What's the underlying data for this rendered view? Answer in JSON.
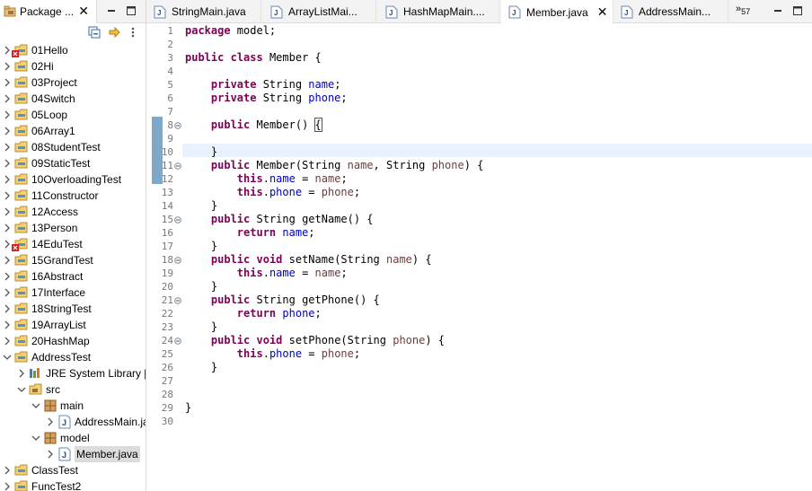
{
  "package_explorer": {
    "tab_label": "Package ...",
    "tree": [
      {
        "label": "01Hello",
        "level": 0,
        "type": "project",
        "state": "collapsed",
        "error": true
      },
      {
        "label": "02Hi",
        "level": 0,
        "type": "project",
        "state": "collapsed",
        "error": false
      },
      {
        "label": "03Project",
        "level": 0,
        "type": "project",
        "state": "collapsed",
        "error": false
      },
      {
        "label": "04Switch",
        "level": 0,
        "type": "project",
        "state": "collapsed",
        "error": false
      },
      {
        "label": "05Loop",
        "level": 0,
        "type": "project",
        "state": "collapsed",
        "error": false
      },
      {
        "label": "06Array1",
        "level": 0,
        "type": "project",
        "state": "collapsed",
        "error": false
      },
      {
        "label": "08StudentTest",
        "level": 0,
        "type": "project",
        "state": "collapsed",
        "error": false
      },
      {
        "label": "09StaticTest",
        "level": 0,
        "type": "project",
        "state": "collapsed",
        "error": false
      },
      {
        "label": "10OverloadingTest",
        "level": 0,
        "type": "project",
        "state": "collapsed",
        "error": false
      },
      {
        "label": "11Constructor",
        "level": 0,
        "type": "project",
        "state": "collapsed",
        "error": false
      },
      {
        "label": "12Access",
        "level": 0,
        "type": "project",
        "state": "collapsed",
        "error": false
      },
      {
        "label": "13Person",
        "level": 0,
        "type": "project",
        "state": "collapsed",
        "error": false
      },
      {
        "label": "14EduTest",
        "level": 0,
        "type": "project",
        "state": "collapsed",
        "error": true
      },
      {
        "label": "15GrandTest",
        "level": 0,
        "type": "project",
        "state": "collapsed",
        "error": false
      },
      {
        "label": "16Abstract",
        "level": 0,
        "type": "project",
        "state": "collapsed",
        "error": false
      },
      {
        "label": "17Interface",
        "level": 0,
        "type": "project",
        "state": "collapsed",
        "error": false
      },
      {
        "label": "18StringTest",
        "level": 0,
        "type": "project",
        "state": "collapsed",
        "error": false
      },
      {
        "label": "19ArrayList",
        "level": 0,
        "type": "project",
        "state": "collapsed",
        "error": false
      },
      {
        "label": "20HashMap",
        "level": 0,
        "type": "project",
        "state": "collapsed",
        "error": false
      },
      {
        "label": "AddressTest",
        "level": 0,
        "type": "project",
        "state": "expanded",
        "error": false
      },
      {
        "label": "JRE System Library [J",
        "level": 1,
        "type": "library",
        "state": "collapsed",
        "error": false
      },
      {
        "label": "src",
        "level": 1,
        "type": "srcfolder",
        "state": "expanded",
        "error": false
      },
      {
        "label": "main",
        "level": 2,
        "type": "package",
        "state": "expanded",
        "error": false
      },
      {
        "label": "AddressMain.ja",
        "level": 3,
        "type": "javafile",
        "state": "collapsed",
        "error": false
      },
      {
        "label": "model",
        "level": 2,
        "type": "package",
        "state": "expanded",
        "error": false
      },
      {
        "label": "Member.java",
        "level": 3,
        "type": "javafile",
        "state": "collapsed",
        "error": false,
        "selected": true
      },
      {
        "label": "ClassTest",
        "level": 0,
        "type": "project",
        "state": "collapsed",
        "error": false
      },
      {
        "label": "FuncTest2",
        "level": 0,
        "type": "project",
        "state": "collapsed",
        "error": false
      }
    ]
  },
  "editor": {
    "tabs": [
      {
        "label": "StringMain.java",
        "active": false
      },
      {
        "label": "ArrayListMai...",
        "active": false
      },
      {
        "label": "HashMapMain....",
        "active": false
      },
      {
        "label": "Member.java",
        "active": true
      },
      {
        "label": "AddressMain...",
        "active": false
      }
    ],
    "overflow_label": "»",
    "overflow_count": "57",
    "lines": [
      {
        "n": "1",
        "fold": false,
        "tokens": [
          [
            "kw",
            "package"
          ],
          [
            "t",
            " model;"
          ]
        ]
      },
      {
        "n": "2",
        "fold": false,
        "tokens": []
      },
      {
        "n": "3",
        "fold": false,
        "tokens": [
          [
            "kw",
            "public"
          ],
          [
            "t",
            " "
          ],
          [
            "kw",
            "class"
          ],
          [
            "t",
            " Member {"
          ]
        ]
      },
      {
        "n": "4",
        "fold": false,
        "tokens": []
      },
      {
        "n": "5",
        "fold": false,
        "tokens": [
          [
            "t",
            "    "
          ],
          [
            "kw",
            "private"
          ],
          [
            "t",
            " String "
          ],
          [
            "fld",
            "name"
          ],
          [
            "t",
            ";"
          ]
        ]
      },
      {
        "n": "6",
        "fold": false,
        "tokens": [
          [
            "t",
            "    "
          ],
          [
            "kw",
            "private"
          ],
          [
            "t",
            " String "
          ],
          [
            "fld",
            "phone"
          ],
          [
            "t",
            ";"
          ]
        ]
      },
      {
        "n": "7",
        "fold": false,
        "tokens": []
      },
      {
        "n": "8",
        "fold": true,
        "tokens": [
          [
            "t",
            "    "
          ],
          [
            "kw",
            "public"
          ],
          [
            "t",
            " Member() "
          ],
          [
            "box",
            "{"
          ]
        ]
      },
      {
        "n": "9",
        "fold": false,
        "tokens": []
      },
      {
        "n": "10",
        "fold": false,
        "tokens": [
          [
            "t",
            "    }"
          ]
        ]
      },
      {
        "n": "11",
        "fold": true,
        "tokens": [
          [
            "t",
            "    "
          ],
          [
            "kw",
            "public"
          ],
          [
            "t",
            " Member(String "
          ],
          [
            "prm",
            "name"
          ],
          [
            "t",
            ", String "
          ],
          [
            "prm",
            "phone"
          ],
          [
            "t",
            ") {"
          ]
        ]
      },
      {
        "n": "12",
        "fold": false,
        "tokens": [
          [
            "t",
            "        "
          ],
          [
            "kw",
            "this"
          ],
          [
            "t",
            "."
          ],
          [
            "fld",
            "name"
          ],
          [
            "t",
            " = "
          ],
          [
            "prm",
            "name"
          ],
          [
            "t",
            ";"
          ]
        ]
      },
      {
        "n": "13",
        "fold": false,
        "tokens": [
          [
            "t",
            "        "
          ],
          [
            "kw",
            "this"
          ],
          [
            "t",
            "."
          ],
          [
            "fld",
            "phone"
          ],
          [
            "t",
            " = "
          ],
          [
            "prm",
            "phone"
          ],
          [
            "t",
            ";"
          ]
        ]
      },
      {
        "n": "14",
        "fold": false,
        "tokens": [
          [
            "t",
            "    }"
          ]
        ]
      },
      {
        "n": "15",
        "fold": true,
        "tokens": [
          [
            "t",
            "    "
          ],
          [
            "kw",
            "public"
          ],
          [
            "t",
            " String getName() {"
          ]
        ]
      },
      {
        "n": "16",
        "fold": false,
        "tokens": [
          [
            "t",
            "        "
          ],
          [
            "kw",
            "return"
          ],
          [
            "t",
            " "
          ],
          [
            "fld",
            "name"
          ],
          [
            "t",
            ";"
          ]
        ]
      },
      {
        "n": "17",
        "fold": false,
        "tokens": [
          [
            "t",
            "    }"
          ]
        ]
      },
      {
        "n": "18",
        "fold": true,
        "tokens": [
          [
            "t",
            "    "
          ],
          [
            "kw",
            "public"
          ],
          [
            "t",
            " "
          ],
          [
            "kw",
            "void"
          ],
          [
            "t",
            " setName(String "
          ],
          [
            "prm",
            "name"
          ],
          [
            "t",
            ") {"
          ]
        ]
      },
      {
        "n": "19",
        "fold": false,
        "tokens": [
          [
            "t",
            "        "
          ],
          [
            "kw",
            "this"
          ],
          [
            "t",
            "."
          ],
          [
            "fld",
            "name"
          ],
          [
            "t",
            " = "
          ],
          [
            "prm",
            "name"
          ],
          [
            "t",
            ";"
          ]
        ]
      },
      {
        "n": "20",
        "fold": false,
        "tokens": [
          [
            "t",
            "    }"
          ]
        ]
      },
      {
        "n": "21",
        "fold": true,
        "tokens": [
          [
            "t",
            "    "
          ],
          [
            "kw",
            "public"
          ],
          [
            "t",
            " String getPhone() {"
          ]
        ]
      },
      {
        "n": "22",
        "fold": false,
        "tokens": [
          [
            "t",
            "        "
          ],
          [
            "kw",
            "return"
          ],
          [
            "t",
            " "
          ],
          [
            "fld",
            "phone"
          ],
          [
            "t",
            ";"
          ]
        ]
      },
      {
        "n": "23",
        "fold": false,
        "tokens": [
          [
            "t",
            "    }"
          ]
        ]
      },
      {
        "n": "24",
        "fold": true,
        "tokens": [
          [
            "t",
            "    "
          ],
          [
            "kw",
            "public"
          ],
          [
            "t",
            " "
          ],
          [
            "kw",
            "void"
          ],
          [
            "t",
            " setPhone(String "
          ],
          [
            "prm",
            "phone"
          ],
          [
            "t",
            ") {"
          ]
        ]
      },
      {
        "n": "25",
        "fold": false,
        "tokens": [
          [
            "t",
            "        "
          ],
          [
            "kw",
            "this"
          ],
          [
            "t",
            "."
          ],
          [
            "fld",
            "phone"
          ],
          [
            "t",
            " = "
          ],
          [
            "prm",
            "phone"
          ],
          [
            "t",
            ";"
          ]
        ]
      },
      {
        "n": "26",
        "fold": false,
        "tokens": [
          [
            "t",
            "    }"
          ]
        ]
      },
      {
        "n": "27",
        "fold": false,
        "tokens": []
      },
      {
        "n": "28",
        "fold": false,
        "tokens": []
      },
      {
        "n": "29",
        "fold": false,
        "tokens": [
          [
            "t",
            "}"
          ]
        ]
      },
      {
        "n": "30",
        "fold": false,
        "tokens": []
      }
    ]
  },
  "colors": {
    "keyword": "#7f0055",
    "field": "#0000c0",
    "param": "#6a3e3e",
    "current_line": "#e8f2fe",
    "selection": "#dcdcdc"
  }
}
